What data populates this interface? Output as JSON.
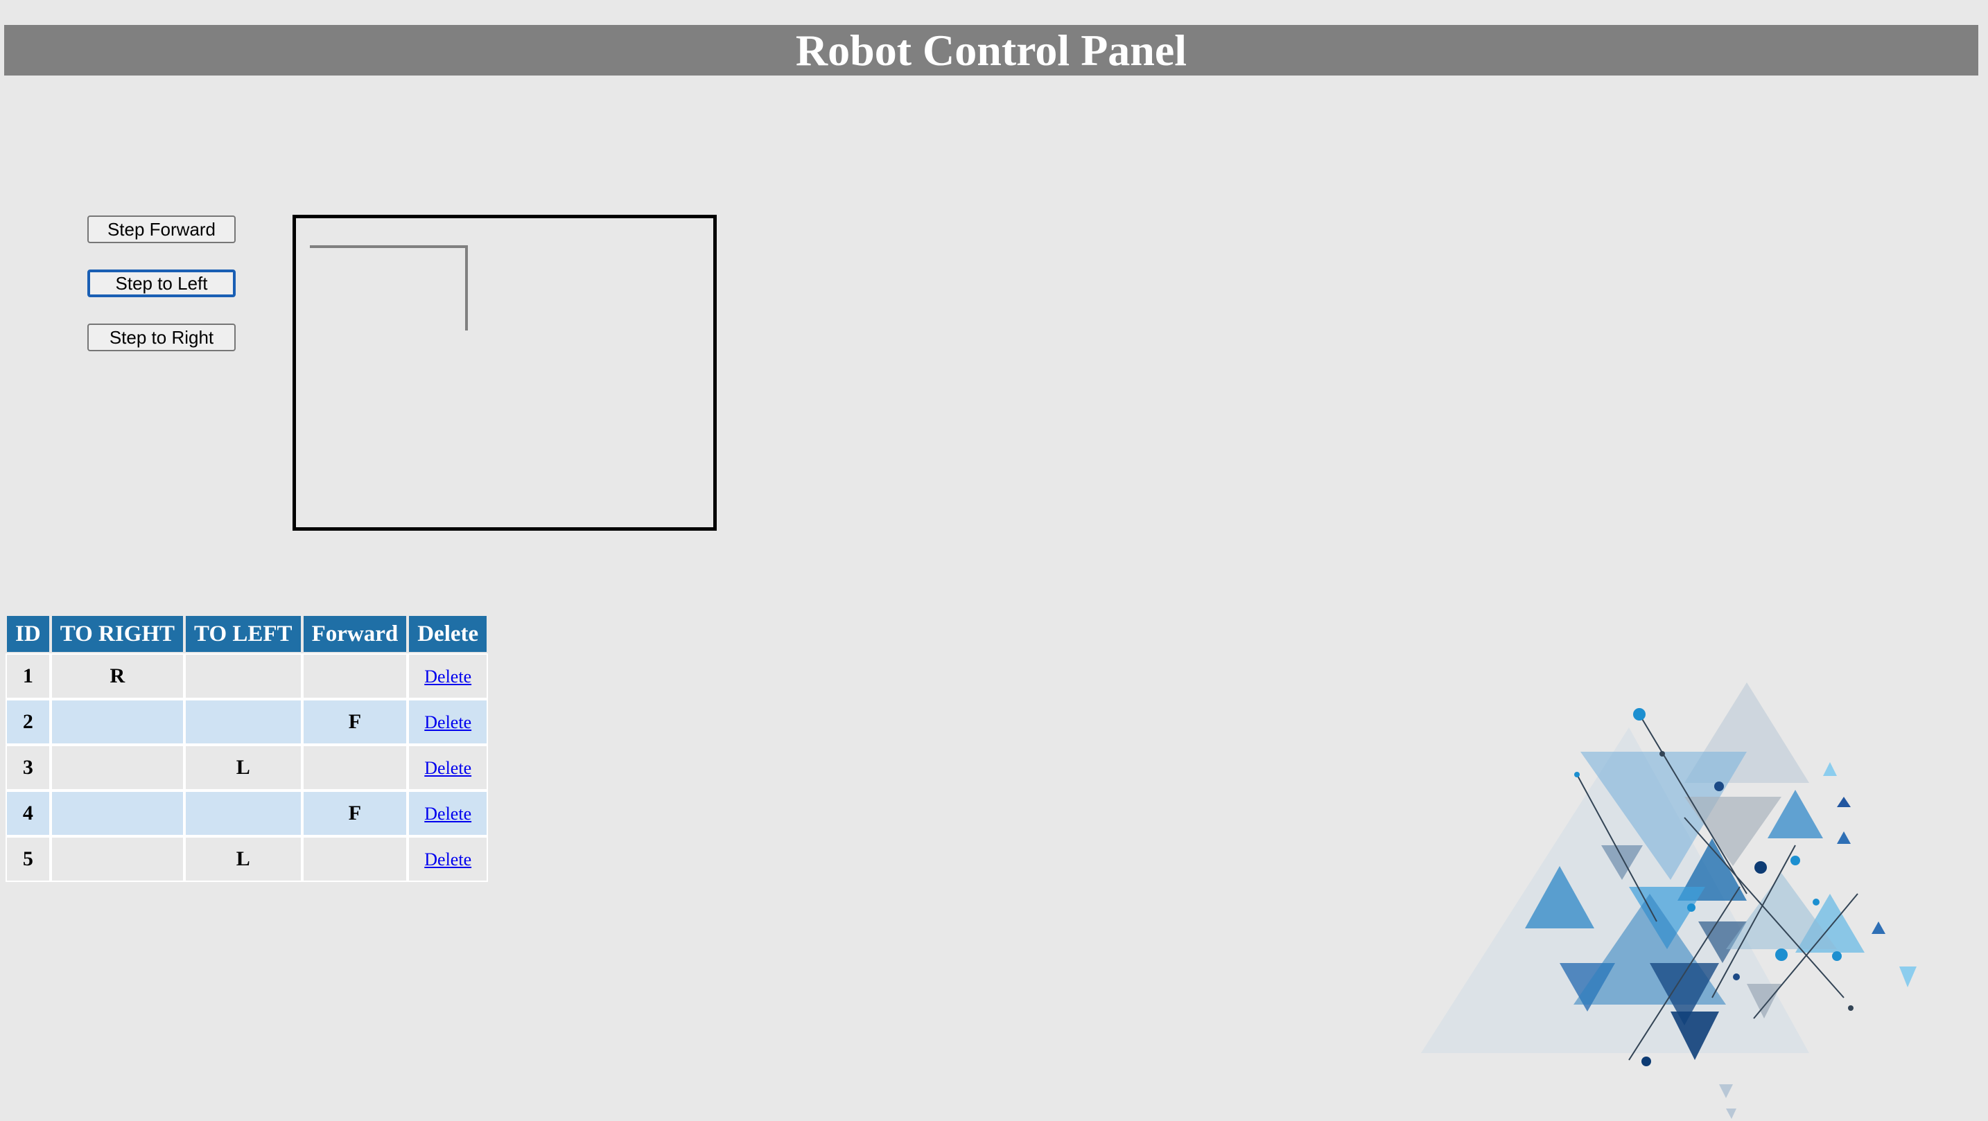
{
  "header": {
    "title": "Robot Control Panel"
  },
  "controls": {
    "step_forward": "Step Forward",
    "step_left": "Step to Left",
    "step_right": "Step to Right"
  },
  "table": {
    "headers": [
      "ID",
      "TO RIGHT",
      "TO LEFT",
      "Forward",
      "Delete"
    ],
    "rows": [
      {
        "id": "1",
        "right": "R",
        "left": "",
        "forward": "",
        "delete": "Delete"
      },
      {
        "id": "2",
        "right": "",
        "left": "",
        "forward": "F",
        "delete": "Delete"
      },
      {
        "id": "3",
        "right": "",
        "left": "L",
        "forward": "",
        "delete": "Delete"
      },
      {
        "id": "4",
        "right": "",
        "left": "",
        "forward": "F",
        "delete": "Delete"
      },
      {
        "id": "5",
        "right": "",
        "left": "L",
        "forward": "",
        "delete": "Delete"
      }
    ]
  },
  "colors": {
    "header_bg": "#808080",
    "table_header_bg": "#1f6fa6",
    "row_stripe": "#cfe2f3",
    "link": "#0000ee"
  }
}
